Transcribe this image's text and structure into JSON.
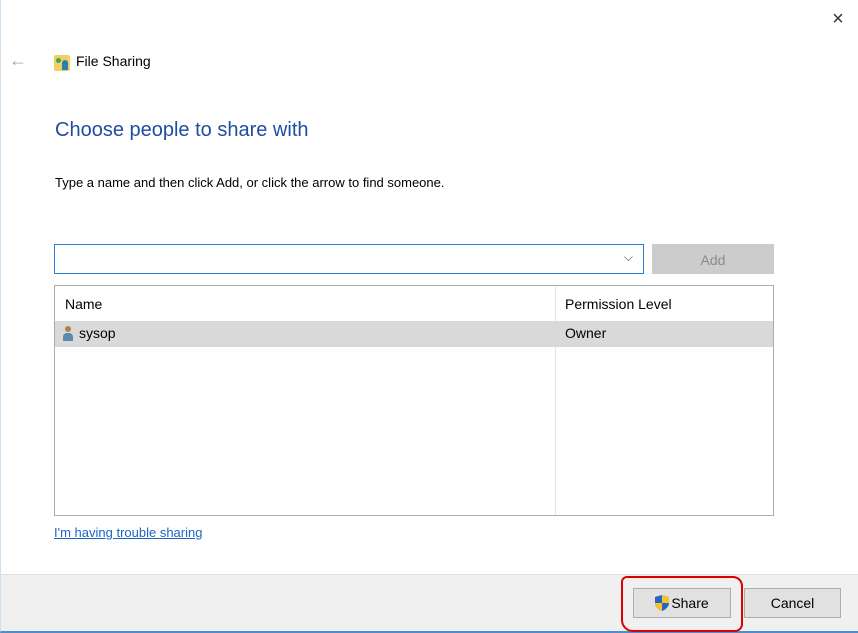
{
  "window": {
    "title": "File Sharing",
    "close_label": "×",
    "back_label": "←"
  },
  "main": {
    "heading": "Choose people to share with",
    "instructions": "Type a name and then click Add, or click the arrow to find someone.",
    "name_input": {
      "value": "",
      "placeholder": ""
    },
    "dropdown_chevron": "⌵",
    "add_label": "Add",
    "table": {
      "columns": [
        "Name",
        "Permission Level"
      ],
      "rows": [
        {
          "name": "sysop",
          "permission": "Owner",
          "selected": true
        }
      ]
    },
    "trouble_link": "I'm having trouble sharing"
  },
  "footer": {
    "share_label": "Share",
    "cancel_label": "Cancel"
  },
  "colors": {
    "heading": "#1f4ea0",
    "link": "#1a66c4",
    "annotation": "#dd0000"
  }
}
